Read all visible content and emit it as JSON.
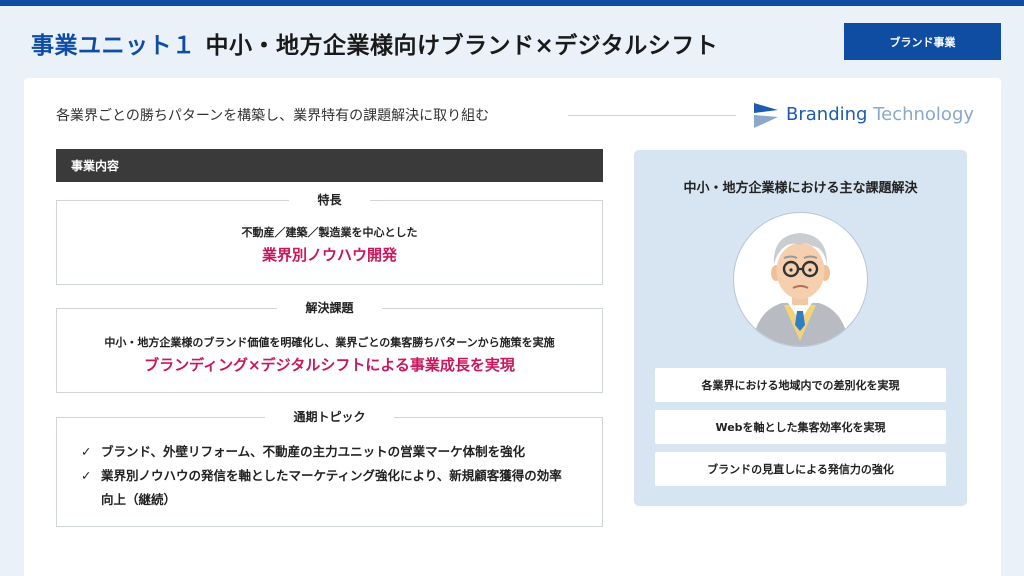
{
  "header": {
    "accent": "事業ユニット１",
    "title": "中小・地方企業様向けブランド×デジタルシフト",
    "tag": "ブランド事業"
  },
  "subtitle": "各業界ごとの勝ちパターンを構築し、業界特有の課題解決に取り組む",
  "logo": {
    "word1": "Branding",
    "word2": "Technology"
  },
  "section": {
    "label": "事業内容"
  },
  "feature": {
    "label": "特長",
    "line1": "不動産／建築／製造業を中心とした",
    "line2": "業界別ノウハウ開発"
  },
  "solution": {
    "label": "解決課題",
    "line1": "中小・地方企業様のブランド価値を明確化し、業界ごとの集客勝ちパターンから施策を実施",
    "line2": "ブランディング×デジタルシフトによる事業成長を実現"
  },
  "topics": {
    "label": "通期トピック",
    "check": "✓",
    "items": [
      "ブランド、外壁リフォーム、不動産の主力ユニットの営業マーケ体制を強化",
      "業界別ノウハウの発信を軸としたマーケティング強化により、新規顧客獲得の効率向上（継続）"
    ]
  },
  "right": {
    "title": "中小・地方企業様における主な課題解決",
    "avatar_icon": "elderly-man-icon",
    "items": [
      "各業界における地域内での差別化を実現",
      "Webを軸とした集客効率化を実現",
      "ブランドの見直しによる発信力の強化"
    ]
  },
  "colors": {
    "brand": "#0f4da3",
    "highlight": "#c8175d",
    "panel": "#d7e4f2",
    "header": "#3a3a3a"
  }
}
